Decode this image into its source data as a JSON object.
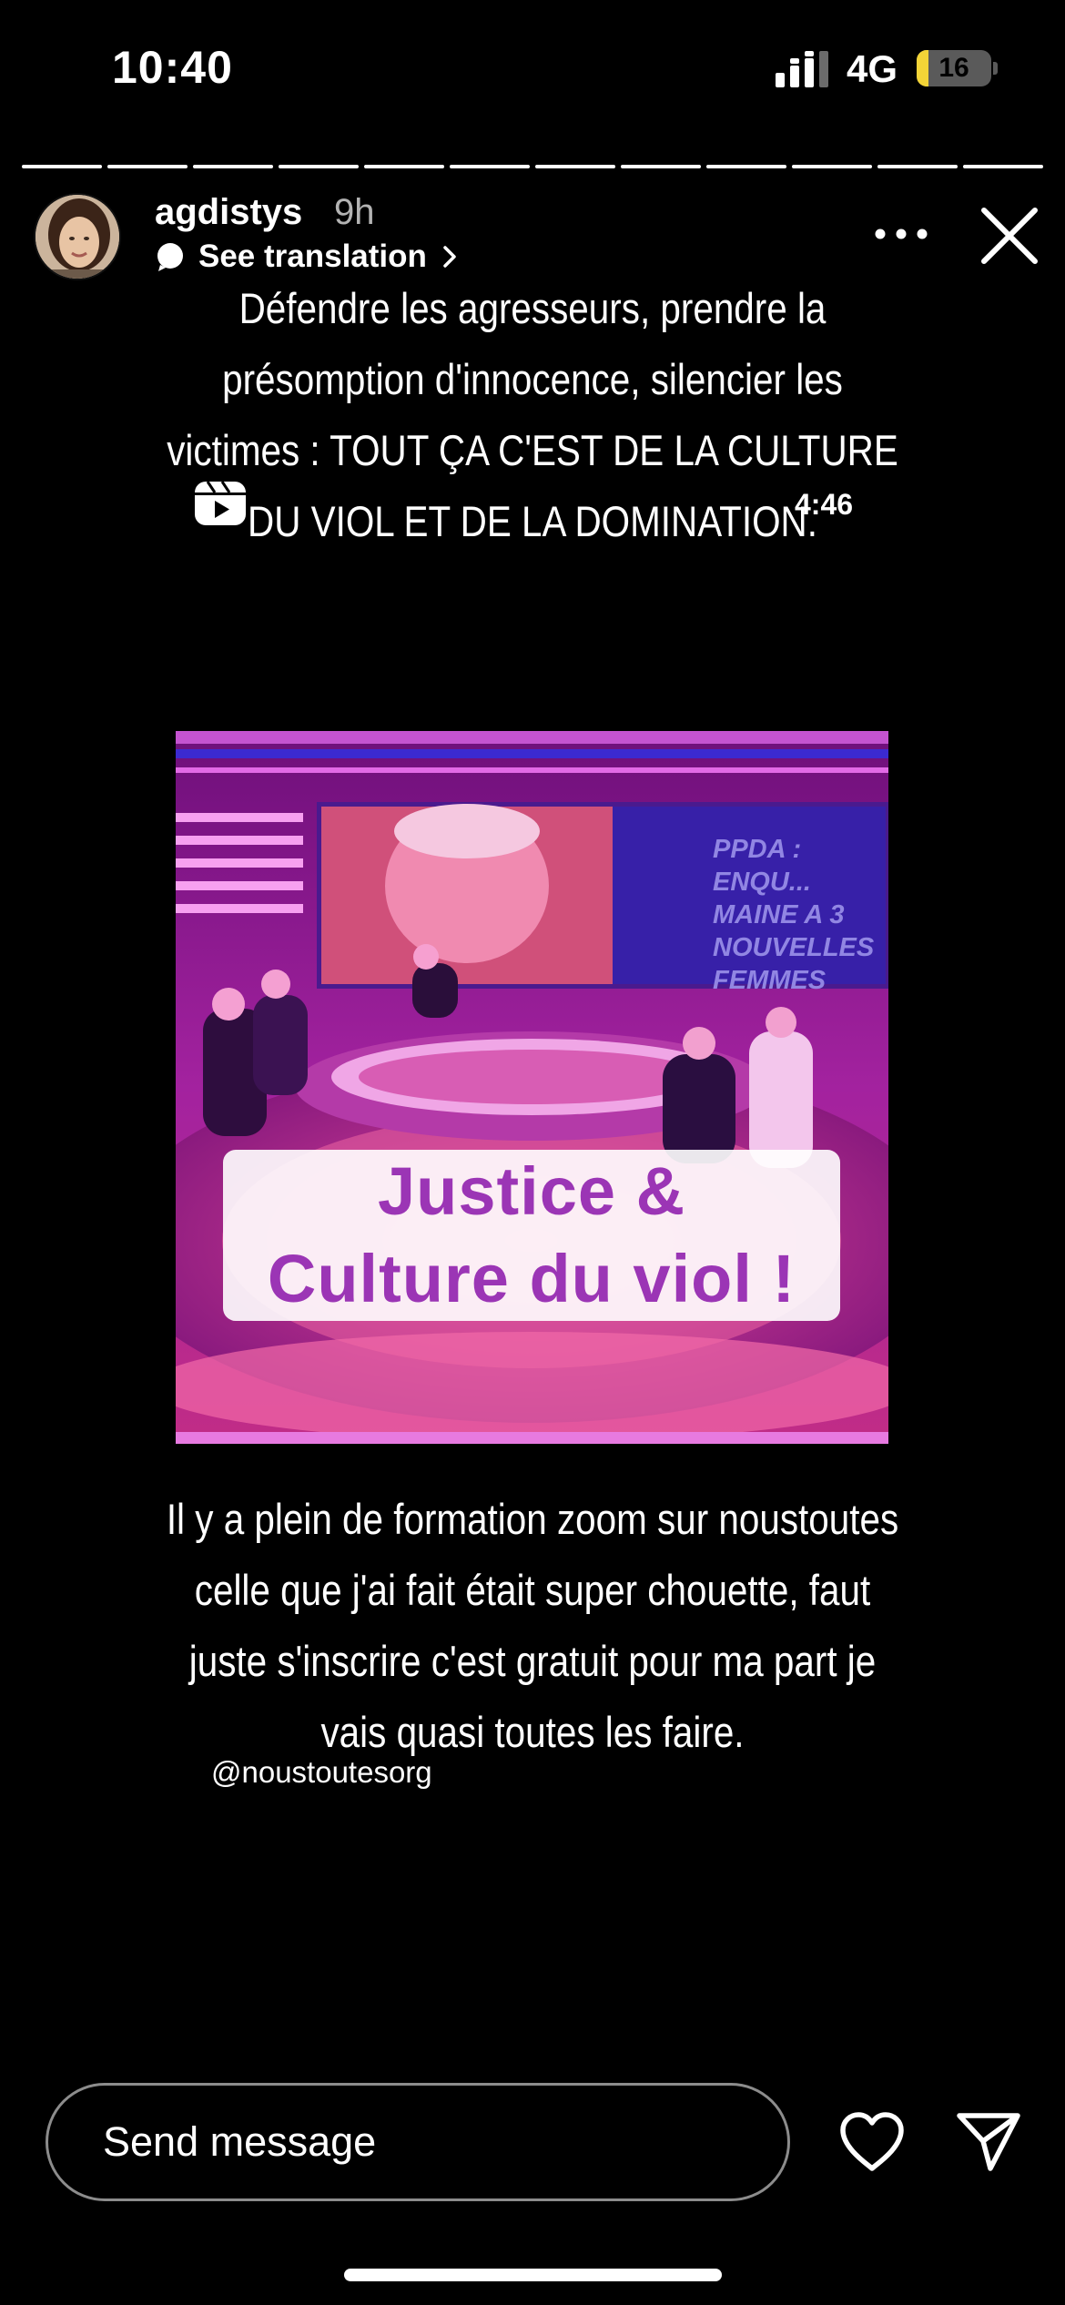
{
  "status_bar": {
    "time": "10:40",
    "network": "4G",
    "battery_level": "16",
    "battery_fraction": 0.16
  },
  "story": {
    "segments_total": 12,
    "segment_current": 12,
    "username": "agdistys",
    "time_ago": "9h",
    "translate_label": "See translation",
    "caption_top": "Défendre les agresseurs, prendre la présomption d'innocence, silencier les victimes : TOUT ÇA C'EST DE LA CULTURE DU VIOL ET DE LA DOMINATION.",
    "reel_duration": "4:46",
    "media": {
      "overlay_text": "PPDA : ENQU... MAINE A 3 NOUVELLES FEMMES",
      "label_line1": "Justice &",
      "label_line2": "Culture du viol !"
    },
    "caption_bottom": "Il y a plein de formation zoom sur noustoutes celle que j'ai fait était super chouette, faut juste s'inscrire c'est gratuit pour ma part je vais quasi toutes les faire.",
    "mention": "@noustoutesorg"
  },
  "footer": {
    "message_placeholder": "Send message"
  },
  "icons": {
    "signal": "signal-bars-icon",
    "more": "more-horizontal-icon",
    "close": "close-icon",
    "translate": "speech-bubble-icon",
    "reel": "reels-icon",
    "like": "heart-outline-icon",
    "share": "paper-plane-icon"
  },
  "colors": {
    "background": "#000000",
    "battery_fill": "#f3d437",
    "media_label_text": "#9b35b5"
  }
}
